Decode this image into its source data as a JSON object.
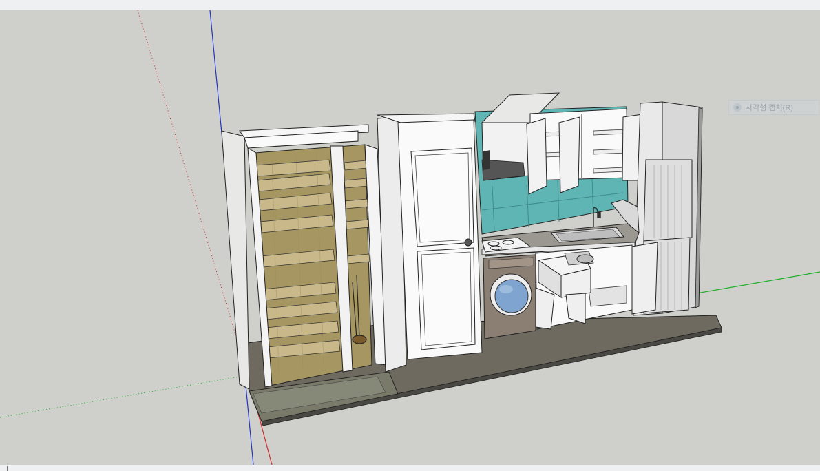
{
  "app": {
    "toolbar": "",
    "statusbar": ""
  },
  "tooltip": {
    "label": "사각형 캡처(R)",
    "icon": "capture-icon"
  },
  "scene": {
    "axes": {
      "red": "#d12a2a",
      "green": "#1fae2a",
      "blue": "#2233c8"
    },
    "colors": {
      "background": "#cfd0cb",
      "cabinet_white": "#f4f4f4",
      "wood": "#b8a67a",
      "teal_tile": "#5fb5b3",
      "floor": "#6e6a60",
      "washer": "#8b7f74"
    }
  }
}
